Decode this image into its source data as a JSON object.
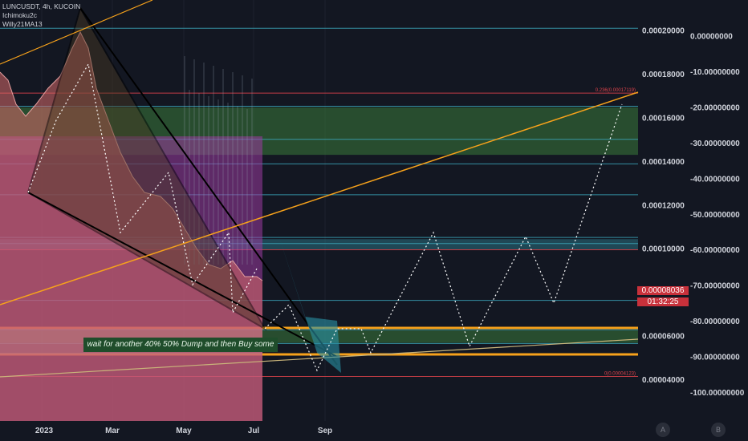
{
  "legend": {
    "symbol": "LUNCUSDT, 4h, KUCOIN",
    "indicators": [
      "Ichimoku2c",
      "Willy21MA13"
    ]
  },
  "chart_data": {
    "type": "line",
    "price_axis": {
      "ticks": [
        0.0002,
        0.00018,
        0.00016,
        0.00014,
        0.00012,
        0.0001,
        6e-05,
        4e-05
      ],
      "tick_labels": [
        "0.00020000",
        "0.00018000",
        "0.00016000",
        "0.00014000",
        "0.00012000",
        "0.00010000",
        "0.00006000",
        "0.00004000"
      ]
    },
    "oscillator_axis": {
      "ticks": [
        0,
        -10,
        -20,
        -30,
        -40,
        -50,
        -60,
        -70,
        -80,
        -90,
        -100
      ],
      "tick_labels": [
        "0.00000000",
        "-10.00000000",
        "-20.00000000",
        "-30.00000000",
        "-40.00000000",
        "-50.00000000",
        "-60.00000000",
        "-70.00000000",
        "-80.00000000",
        "-90.00000000",
        "-100.00000000"
      ]
    },
    "time_axis": {
      "labels": [
        "2023",
        "Mar",
        "May",
        "Jul",
        "Sep"
      ]
    },
    "current_price": {
      "value": "0.00008036",
      "countdown": "01:32:25",
      "color": "#c8313b"
    },
    "fib_levels": [
      {
        "label": "0.236(0.00017119)",
        "price": 0.00017119
      },
      {
        "label": "0(0.00004123)",
        "price": 4.123e-05
      }
    ],
    "horizontal_lines": [
      0.00020088,
      0.00017119,
      0.00016517,
      0.00015,
      0.00013872,
      0.00012457,
      0.000105,
      0.00010217,
      9.933e-05,
      7.611e-05,
      6.261e-05,
      5.639e-05,
      4.123e-05
    ],
    "zones": [
      {
        "name": "green-upper",
        "from": 0.00014286,
        "to": 0.00016462,
        "color": "#3a7a3a"
      },
      {
        "name": "cyan-mid",
        "from": 9.953e-05,
        "to": 0.00010424,
        "color": "#2a6f80"
      },
      {
        "name": "green-lower",
        "from": 5.668e-05,
        "to": 6.236e-05,
        "color": "#3a7a3a"
      }
    ],
    "annotation": "wait for another 40% 50% Dump and then Buy some"
  },
  "buttons": {
    "a": "A",
    "b": "B"
  }
}
